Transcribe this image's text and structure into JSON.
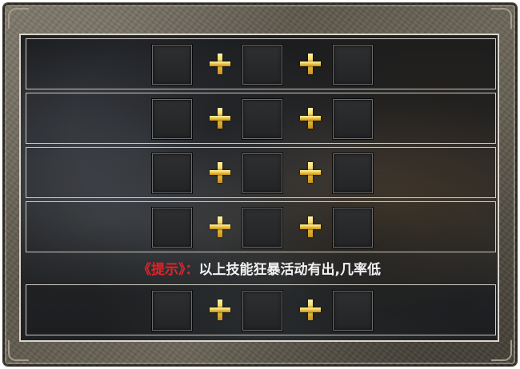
{
  "panel": {
    "rows": [
      {
        "slots": [
          "",
          "",
          ""
        ],
        "operators": [
          "+",
          "+"
        ]
      },
      {
        "slots": [
          "",
          "",
          ""
        ],
        "operators": [
          "+",
          "+"
        ]
      },
      {
        "slots": [
          "",
          "",
          ""
        ],
        "operators": [
          "+",
          "+"
        ]
      },
      {
        "slots": [
          "",
          "",
          ""
        ],
        "operators": [
          "+",
          "+"
        ]
      }
    ],
    "hint": {
      "label": "《提示》：",
      "text": "以上技能狂暴活动有出,几率低",
      "label_color": "#e0242a",
      "text_color": "#f2f2f2"
    },
    "bonus_row": {
      "slots": [
        "",
        "",
        ""
      ],
      "operators": [
        "+",
        "+"
      ]
    }
  },
  "colors": {
    "frame": "#6e685b",
    "plus": "#f2cc4a",
    "slot_bg": "#2a2b2d",
    "border": "#d9d5ca"
  },
  "icons": [
    "plus-icon"
  ]
}
